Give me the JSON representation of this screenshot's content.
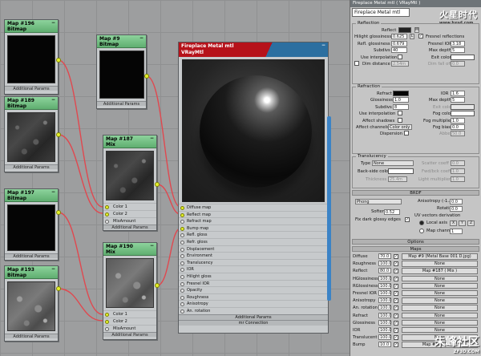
{
  "nodes": {
    "map196": {
      "title": "Map #196",
      "type": "Bitmap",
      "addp": "Additional Params"
    },
    "map189": {
      "title": "Map #189",
      "type": "Bitmap",
      "addp": "Additional Params"
    },
    "map197": {
      "title": "Map #197",
      "type": "Bitmap",
      "addp": "Additional Params"
    },
    "map193": {
      "title": "Map #193",
      "type": "Bitmap",
      "addp": "Additional Params"
    },
    "map9": {
      "title": "Map #9",
      "type": "Bitmap",
      "addp": "Additional Params"
    },
    "map187": {
      "title": "Map #187",
      "type": "Mix",
      "slots": [
        "Color 1",
        "Color 2",
        "MixAmount"
      ],
      "addp": "Additional Params"
    },
    "map190": {
      "title": "Map #190",
      "type": "Mix",
      "slots": [
        "Color 1",
        "Color 2",
        "MixAmount"
      ],
      "addp": "Additional Params"
    },
    "min": "−"
  },
  "material_node": {
    "title": "Fireplace Metal mtl",
    "type": "VRayMtl",
    "slots": [
      "Diffuse map",
      "Reflect map",
      "Refract map",
      "Bump map",
      "Refl. gloss",
      "Refr. gloss",
      "Displacement",
      "Environment",
      "Translucency",
      "IOR",
      "Hilight gloss",
      "Fresnel IOR",
      "Opacity",
      "Roughness",
      "Anisotropy",
      "An. rotation"
    ],
    "addp": "Additional Params",
    "connection": "mr Connection"
  },
  "panel": {
    "title": "Fireplace Metal mtl  ( VRayMtl )",
    "name": "Fireplace Metal mtl",
    "logo": "火星时代",
    "logo_url": "www.hxsd.com",
    "reflection": {
      "title": "Reflection",
      "reflect": "Reflect",
      "m": "M",
      "hg": "Hilight glossiness",
      "hg_val": "0.625",
      "rg": "Refl. glossiness",
      "rg_val": "0.679",
      "subdivs": "Subdivs",
      "subdivs_val": "40",
      "use_interp": "Use interpolation",
      "dim": "Dim distance",
      "dim_val": "2.54m",
      "fresnel": "Fresnel reflections",
      "fior": "Fresnel IOR",
      "fior_val": "3.18",
      "maxd": "Max depth",
      "maxd_val": "5",
      "exit": "Exit color",
      "dimf": "Dim fall off",
      "dimf_val": "0.0",
      "l": "L"
    },
    "refraction": {
      "title": "Refraction",
      "refract": "Refract",
      "gloss": "Glossiness",
      "gloss_val": "1.0",
      "subdivs": "Subdivs",
      "subdivs_val": "8",
      "use_interp": "Use interpolation",
      "shadows": "Affect shadows",
      "channels": "Affect channels",
      "channels_val": "Color only",
      "ior": "IOR",
      "ior_val": "1.6",
      "maxd": "Max depth",
      "maxd_val": "5",
      "exit": "Exit color",
      "fog": "Fog color",
      "fogm": "Fog multiplier",
      "fogm_val": "1.0",
      "fogb": "Fog bias",
      "fogb_val": "0.0",
      "disp": "Dispersion",
      "abbe": "Abbe",
      "abbe_val": "50.0"
    },
    "translucency": {
      "title": "Translucency",
      "type": "Type",
      "type_val": "None",
      "back": "Back-side color",
      "thick": "Thickness",
      "thick_val": "25.4m",
      "scatter": "Scatter coeff",
      "scatter_val": "0.0",
      "fwd": "Fwd/bck coeff",
      "fwd_val": "1.0",
      "light": "Light multiplier",
      "light_val": "1.0"
    },
    "brdf": {
      "title": "BRDF",
      "type_val": "Phong",
      "soften": "Soften",
      "soften_val": "0.52",
      "fix": "Fix dark glossy edges",
      "aniso": "Anisotropy (-1..1)",
      "aniso_val": "0.0",
      "rot": "Rotation",
      "rot_val": "0.0",
      "uv": "UV vectors derivation",
      "local": "Local axis",
      "x": "X",
      "y": "Y",
      "z": "Z",
      "mapch": "Map channel",
      "mapch_val": "1"
    },
    "options": "Options",
    "maps": {
      "title": "Maps",
      "rows": [
        {
          "name": "Diffuse",
          "val": "70.0",
          "map": "Map #9 (Metal Base 001 D.jpg)"
        },
        {
          "name": "Roughness",
          "val": "100.0",
          "map": "None"
        },
        {
          "name": "Reflect",
          "val": "80.0",
          "map": "Map #187 ( Mix )"
        },
        {
          "name": "HGlossiness",
          "val": "100.0",
          "map": "None"
        },
        {
          "name": "RGlossiness",
          "val": "100.0",
          "map": "None"
        },
        {
          "name": "Fresnel IOR",
          "val": "100.0",
          "map": "None"
        },
        {
          "name": "Anisotropy",
          "val": "100.0",
          "map": "None"
        },
        {
          "name": "An. rotation",
          "val": "100.0",
          "map": "None"
        },
        {
          "name": "Refract",
          "val": "100.0",
          "map": "None"
        },
        {
          "name": "Glossiness",
          "val": "100.0",
          "map": "None"
        },
        {
          "name": "IOR",
          "val": "100.0",
          "map": "None"
        },
        {
          "name": "Translucent",
          "val": "100.0",
          "map": "None"
        },
        {
          "name": "Bump",
          "val": "10.0",
          "map": "Map #190 ( Mix )"
        }
      ]
    },
    "check": "✓"
  },
  "watermark": {
    "text": "朱峰社区",
    "url": "ZF3D.COM"
  }
}
